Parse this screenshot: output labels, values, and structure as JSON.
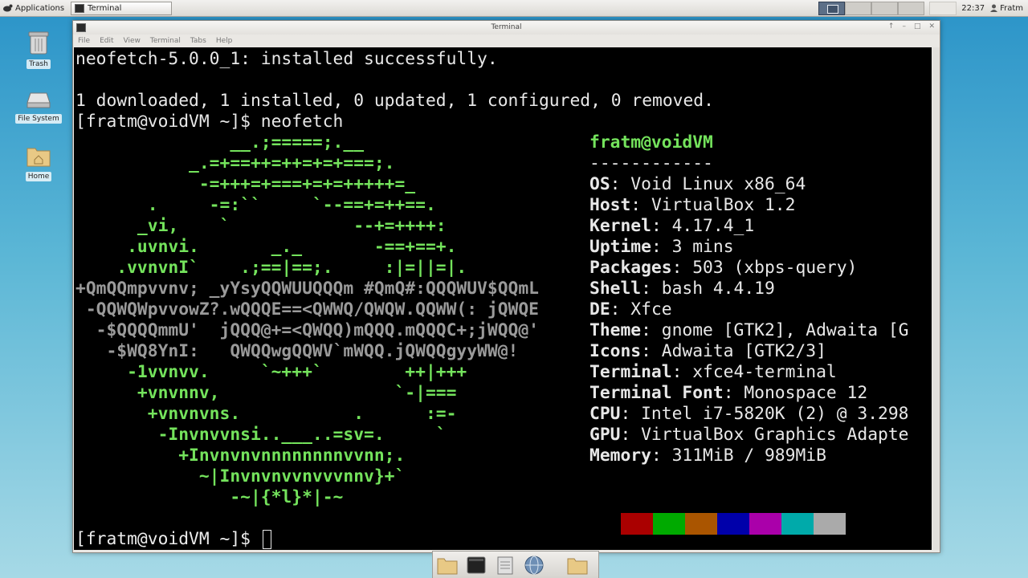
{
  "top_panel": {
    "applications_label": "Applications",
    "task_label": "Terminal",
    "clock": "22:37",
    "user": "Fratm"
  },
  "desktop": {
    "icons": [
      {
        "label": "Trash",
        "icon": "trash-icon"
      },
      {
        "label": "File System",
        "icon": "drive-icon"
      },
      {
        "label": "Home",
        "icon": "home-folder-icon"
      }
    ]
  },
  "window": {
    "title": "Terminal",
    "menu": [
      "File",
      "Edit",
      "View",
      "Terminal",
      "Tabs",
      "Help"
    ]
  },
  "terminal": {
    "lines": [
      "neofetch-5.0.0_1: installed successfully.",
      "",
      "1 downloaded, 1 installed, 0 updated, 1 configured, 0 removed.",
      "[fratm@voidVM ~]$ neofetch"
    ],
    "ascii_logo": [
      "               __.;=====;.__",
      "           _.=+==++=++=+=+===;.",
      "            -=+++=+===+=+=+++++=_",
      "       .     -=:``     `--==+=++==.",
      "      _vi,    `            --+=++++:",
      "     .uvnvi.       _._       -==+==+.",
      "    .vvnvnI`    .;==|==;.     :|=||=|.",
      "+QmQQmpvvnv; _yYsyQQWUUQQQm #QmQ#:QQQWUV$QQmL",
      " -QQWQWpvvowZ?.wQQQE==<QWWQ/QWQW.QQWW(: jQWQE",
      "  -$QQQQmmU'  jQQQ@+=<QWQQ)mQQQ.mQQQC+;jWQQ@'",
      "   -$WQ8YnI:   QWQQwgQQWV`mWQQ.jQWQQgyyWW@!",
      "     -1vvnvv.     `~+++`        ++|+++",
      "      +vnvnnv,                 `-|===",
      "       +vnvnvns.           .      :=-",
      "        -Invnvvnsi..___..=sv=.     `",
      "          +Invnvnvnnnnnnnnvvnn;.",
      "            ~|Invnvnvvnvvvnnv}+`",
      "               -~|{*l}*|-~"
    ],
    "info": {
      "user_host": "fratm@voidVM",
      "separator": "------------",
      "fields": [
        {
          "key": "OS",
          "value": "Void Linux x86_64"
        },
        {
          "key": "Host",
          "value": "VirtualBox 1.2"
        },
        {
          "key": "Kernel",
          "value": "4.17.4_1"
        },
        {
          "key": "Uptime",
          "value": "3 mins"
        },
        {
          "key": "Packages",
          "value": "503 (xbps-query)"
        },
        {
          "key": "Shell",
          "value": "bash 4.4.19"
        },
        {
          "key": "DE",
          "value": "Xfce"
        },
        {
          "key": "Theme",
          "value": "gnome [GTK2], Adwaita [G"
        },
        {
          "key": "Icons",
          "value": "Adwaita [GTK2/3]"
        },
        {
          "key": "Terminal",
          "value": "xfce4-terminal"
        },
        {
          "key": "Terminal Font",
          "value": "Monospace 12"
        },
        {
          "key": "CPU",
          "value": "Intel i7-5820K (2) @ 3.298"
        },
        {
          "key": "GPU",
          "value": "VirtualBox Graphics Adapte"
        },
        {
          "key": "Memory",
          "value": "311MiB / 989MiB"
        }
      ],
      "color_swatches": [
        "#aa0000",
        "#00aa00",
        "#aa5500",
        "#0000aa",
        "#aa00aa",
        "#00aaaa",
        "#aaaaaa"
      ]
    },
    "final_prompt": "[fratm@voidVM ~]$ "
  },
  "dock": {
    "items": [
      "home-folder-icon",
      "terminal-icon",
      "file-manager-icon",
      "web-browser-icon",
      "folder-icon"
    ]
  },
  "colors": {
    "prompt_green": "#74e35c",
    "terminal_bg": "#000000"
  }
}
